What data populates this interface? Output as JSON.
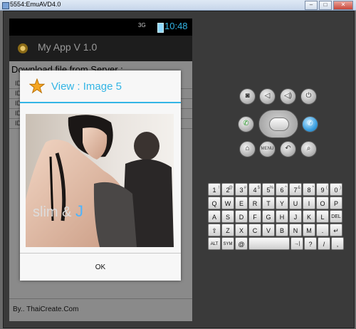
{
  "window": {
    "title": "5554:EmuAVD4.0",
    "controls": [
      "–",
      "□",
      "✕"
    ]
  },
  "statusbar": {
    "signal": "3G",
    "time": "10:48"
  },
  "app": {
    "title": "My App V 1.0"
  },
  "screen": {
    "heading": "Download file from Server :",
    "list_items": [
      "ID",
      "ID",
      "ID",
      "ID",
      "ID"
    ],
    "footer": "By.. ThaiCreate.Com"
  },
  "dialog": {
    "title": "View : Image 5",
    "photo_caption_main": "slim & ",
    "photo_caption_accent": "J",
    "ok_label": "OK"
  },
  "emulator_buttons": {
    "camera": "◙",
    "vol_down": "◁",
    "vol_up": "◁)",
    "power": "⏻",
    "call": "✆",
    "end_call": "✆",
    "home": "⌂",
    "menu": "MENU",
    "back": "↶",
    "search": "⌕"
  },
  "keyboard": {
    "row1": [
      "1",
      "2",
      "3",
      "4",
      "5",
      "6",
      "7",
      "8",
      "9",
      "0"
    ],
    "row1_sup": [
      "!",
      "@",
      "#",
      "$",
      "%",
      "^",
      "&",
      "*",
      "(",
      ")"
    ],
    "row2": [
      "Q",
      "W",
      "E",
      "R",
      "T",
      "Y",
      "U",
      "I",
      "O",
      "P"
    ],
    "row3": [
      "A",
      "S",
      "D",
      "F",
      "G",
      "H",
      "J",
      "K",
      "L",
      "DEL"
    ],
    "row4": [
      "⇧",
      "Z",
      "X",
      "C",
      "V",
      "B",
      "N",
      "M",
      ".",
      "↵"
    ],
    "row5": [
      "ALT",
      "SYM",
      "@",
      "",
      "→|",
      "?",
      "/",
      ","
    ]
  },
  "colors": {
    "accent": "#33b5e5",
    "phone_bg": "#8a8a8a",
    "frame_bg": "#3a3a3a"
  }
}
